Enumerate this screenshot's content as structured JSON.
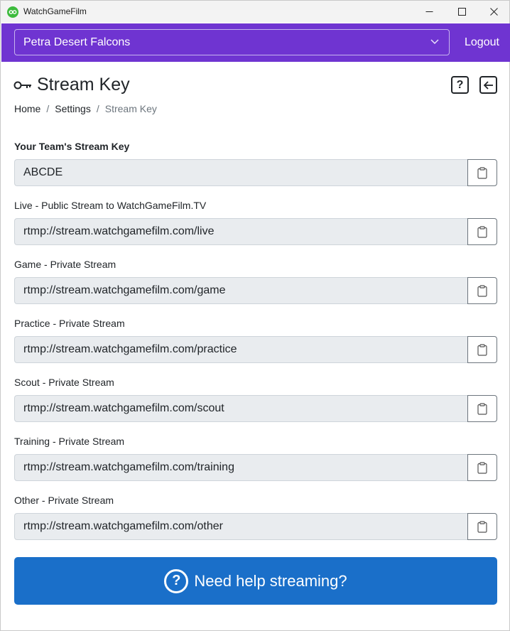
{
  "window": {
    "title": "WatchGameFilm",
    "minimize_glyph": "—",
    "maximize_glyph": "☐",
    "close_glyph": "✕"
  },
  "topbar": {
    "team": "Petra Desert Falcons",
    "logout_label": "Logout",
    "bg_color": "#6f34d1"
  },
  "header": {
    "title": "Stream Key",
    "help_glyph": "?",
    "back_glyph": "←"
  },
  "breadcrumb": {
    "items": [
      "Home",
      "Settings",
      "Stream Key"
    ],
    "separator": "/"
  },
  "fields": [
    {
      "label": "Your Team's Stream Key",
      "value": "ABCDE",
      "bold": true
    },
    {
      "label": "Live - Public Stream to WatchGameFilm.TV",
      "value": "rtmp://stream.watchgamefilm.com/live"
    },
    {
      "label": "Game - Private Stream",
      "value": "rtmp://stream.watchgamefilm.com/game"
    },
    {
      "label": "Practice - Private Stream",
      "value": "rtmp://stream.watchgamefilm.com/practice"
    },
    {
      "label": "Scout - Private Stream",
      "value": "rtmp://stream.watchgamefilm.com/scout"
    },
    {
      "label": "Training - Private Stream",
      "value": "rtmp://stream.watchgamefilm.com/training"
    },
    {
      "label": "Other - Private Stream",
      "value": "rtmp://stream.watchgamefilm.com/other"
    }
  ],
  "help_button": {
    "label": "Need help streaming?",
    "glyph": "?",
    "color": "#1a6fc9"
  }
}
